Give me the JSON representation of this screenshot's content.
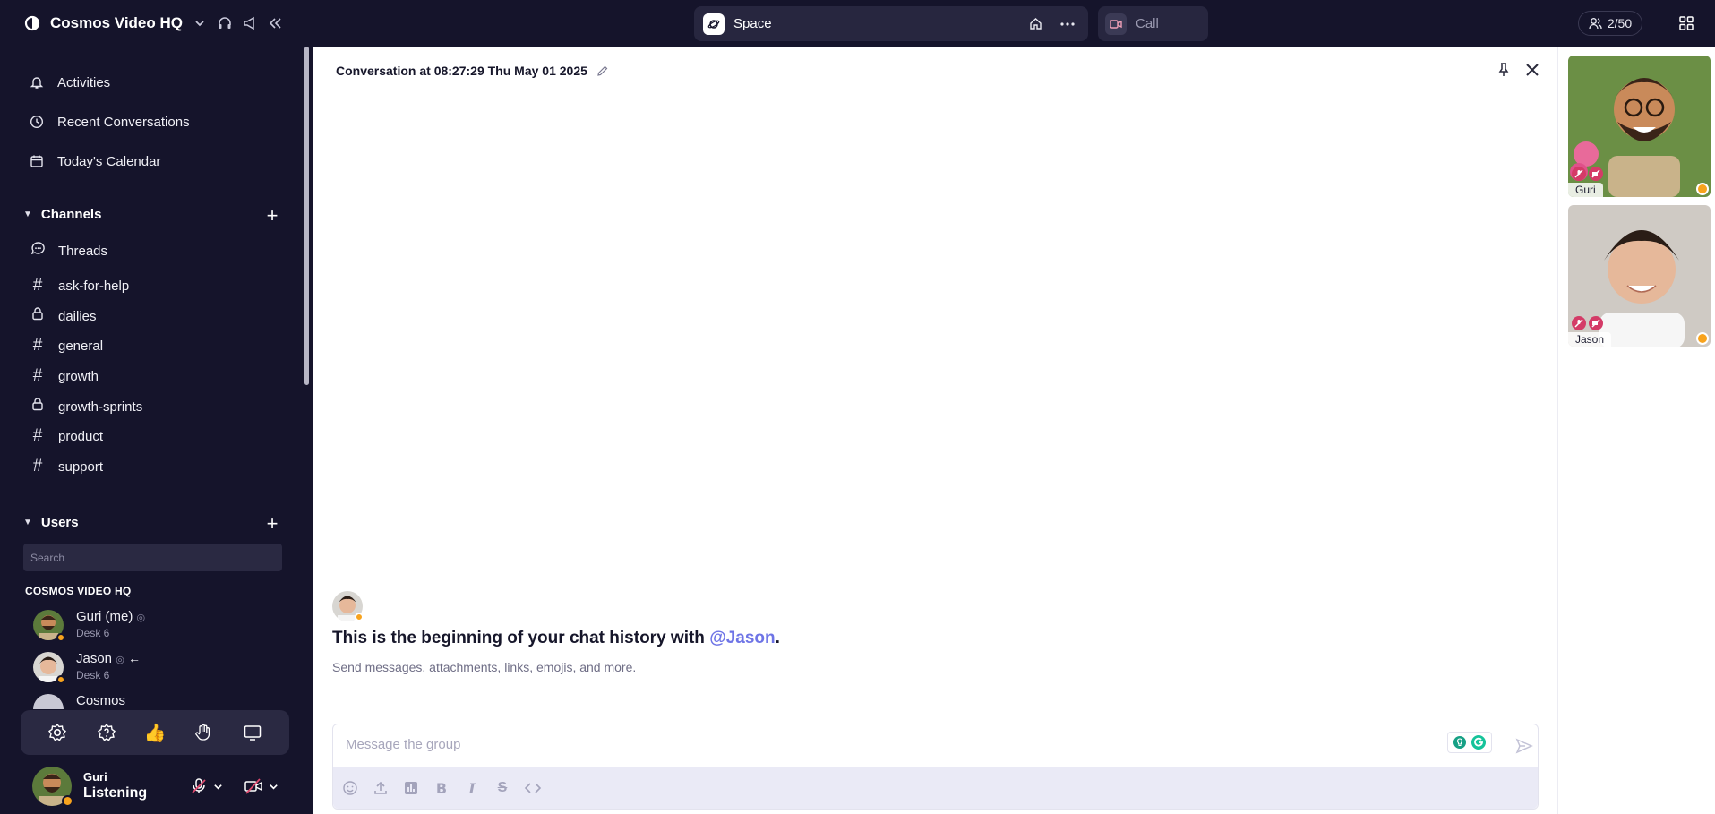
{
  "workspace": {
    "title": "Cosmos Video HQ"
  },
  "space": {
    "label": "Space"
  },
  "call": {
    "label": "Call"
  },
  "participants": {
    "count": "2/50"
  },
  "sidebar": {
    "nav": [
      {
        "label": "Activities",
        "icon": "bell-icon"
      },
      {
        "label": "Recent Conversations",
        "icon": "clock-icon"
      },
      {
        "label": "Today's Calendar",
        "icon": "calendar-icon"
      }
    ],
    "channels_title": "Channels",
    "threads_label": "Threads",
    "channels": [
      {
        "name": "ask-for-help",
        "type": "public"
      },
      {
        "name": "dailies",
        "type": "private"
      },
      {
        "name": "general",
        "type": "public"
      },
      {
        "name": "growth",
        "type": "public"
      },
      {
        "name": "growth-sprints",
        "type": "private"
      },
      {
        "name": "product",
        "type": "public"
      },
      {
        "name": "support",
        "type": "public"
      }
    ],
    "users_title": "Users",
    "search_placeholder": "Search",
    "org_name": "COSMOS VIDEO HQ",
    "users": [
      {
        "name": "Guri (me)",
        "desk": "Desk 6"
      },
      {
        "name": "Jason",
        "desk": "Desk 6"
      },
      {
        "name": "Cosmos",
        "desk": ""
      }
    ]
  },
  "me": {
    "name": "Guri",
    "status": "Listening"
  },
  "conversation": {
    "title": "Conversation at 08:27:29 Thu May 01 2025",
    "history_prefix": "This is the beginning of your chat history with ",
    "history_mention": "@Jason",
    "history_suffix": ".",
    "history_sub": "Send messages, attachments, links, emojis, and more.",
    "composer_placeholder": "Message the group"
  },
  "tiles": [
    {
      "name": "Guri"
    },
    {
      "name": "Jason"
    }
  ],
  "colors": {
    "sidebar_bg": "#15142b",
    "accent_mention": "#6e74e6",
    "presence_away": "#f8a31d"
  }
}
